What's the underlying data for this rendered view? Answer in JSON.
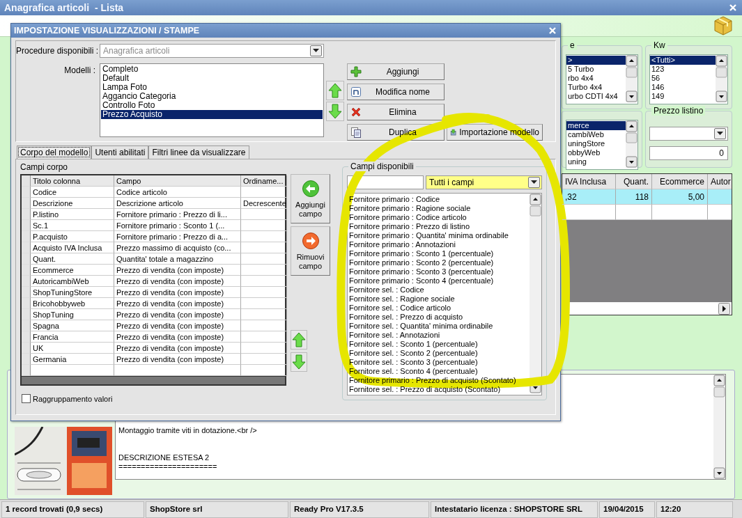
{
  "window": {
    "title": "Anagrafica articoli  - Lista"
  },
  "filters": [
    {
      "title": "e",
      "items": [
        {
          "label": ">",
          "selected": true
        },
        {
          "label": "5 Turbo",
          "selected": false
        },
        {
          "label": "rbo 4x4",
          "selected": false
        },
        {
          "label": "Turbo 4x4",
          "selected": false
        },
        {
          "label": "urbo CDTI 4x4",
          "selected": false
        }
      ]
    },
    {
      "title": "Kw",
      "items": [
        {
          "label": "<Tutti>",
          "selected": true
        },
        {
          "label": "123",
          "selected": false
        },
        {
          "label": "56",
          "selected": false
        },
        {
          "label": "146",
          "selected": false
        },
        {
          "label": "149",
          "selected": false
        }
      ]
    },
    {
      "items": [
        {
          "label": "merce",
          "selected": true
        },
        {
          "label": "cambiWeb",
          "selected": false
        },
        {
          "label": "uningStore",
          "selected": false
        },
        {
          "label": "obbyWeb",
          "selected": false
        },
        {
          "label": "uning",
          "selected": false
        }
      ]
    }
  ],
  "price_list": {
    "title": "Prezzo listino",
    "value": "0"
  },
  "grid": {
    "columns": [
      "IVA Inclusa",
      "Quant.",
      "Ecommerce",
      "Autor"
    ],
    "rows": [
      {
        "cells": [
          ",32",
          "118",
          "5,00"
        ],
        "selected": true
      }
    ]
  },
  "description": {
    "paragraphs": [
      [
        "Montaggio tramite viti in dotazione.<br />"
      ],
      [
        "DESCRIZIONE ESTESA 2",
        "======================"
      ]
    ]
  },
  "status_bar": [
    "1 record trovati (0,9 secs)",
    "ShopStore srl",
    "Ready Pro V17.3.5",
    "Intestatario licenza : SHOPSTORE SRL",
    "19/04/2015",
    "12:20"
  ],
  "dialog": {
    "title": "IMPOSTAZIONE VISUALIZZAZIONI / STAMPE",
    "procedure": {
      "label": "Procedure disponibili :",
      "value": "Anagrafica articoli",
      "disabled": true
    },
    "models": {
      "label": "Modelli :",
      "items": [
        {
          "label": "Completo",
          "selected": false
        },
        {
          "label": "Default",
          "selected": false
        },
        {
          "label": "Lampa Foto",
          "selected": false
        },
        {
          "label": "Aggancio Categoria",
          "selected": false
        },
        {
          "label": "Controllo Foto",
          "selected": false
        },
        {
          "label": "Prezzo Acquisto",
          "selected": true
        }
      ]
    },
    "model_buttons": [
      {
        "label": "Aggiungi"
      },
      {
        "label": "Modifica nome"
      },
      {
        "label": "Elimina"
      },
      {
        "label": "Duplica"
      }
    ],
    "import_button": {
      "label": "Importazione modello"
    },
    "tabs": [
      {
        "label": "Corpo del modello",
        "selected": true
      },
      {
        "label": "Utenti abilitati",
        "selected": false
      },
      {
        "label": "Filtri linee da visualizzare",
        "selected": false
      }
    ],
    "fields": {
      "title": "Campi corpo",
      "columns": [
        "Titolo colonna",
        "Campo",
        "Ordiname..."
      ],
      "rows": [
        [
          "Codice",
          "Codice articolo"
        ],
        [
          "Descrizione",
          "Descrizione articolo",
          "Decrescente"
        ],
        [
          "P.listino",
          "Fornitore primario : Prezzo di li..."
        ],
        [
          "Sc.1",
          "Fornitore primario : Sconto 1 (..."
        ],
        [
          "P.acquisto",
          "Fornitore primario : Prezzo di a..."
        ],
        [
          "Acquisto IVA Inclusa",
          "Prezzo massimo di acquisto (co..."
        ],
        [
          "Quant.",
          "Quantita' totale a magazzino"
        ],
        [
          "Ecommerce",
          "Prezzo di vendita (con imposte)"
        ],
        [
          "AutoricambiWeb",
          "Prezzo di vendita (con imposte)"
        ],
        [
          "ShopTuningStore",
          "Prezzo di vendita (con imposte)"
        ],
        [
          "Bricohobbyweb",
          "Prezzo di vendita (con imposte)"
        ],
        [
          "ShopTuning",
          "Prezzo di vendita (con imposte)"
        ],
        [
          "Spagna",
          "Prezzo di vendita (con imposte)"
        ],
        [
          "Francia",
          "Prezzo di vendita (con imposte)"
        ],
        [
          "UK",
          "Prezzo di vendita (con imposte)"
        ],
        [
          "Germania",
          "Prezzo di vendita (con imposte)"
        ]
      ],
      "buttons": [
        {
          "label": "Aggiungi campo"
        },
        {
          "label": "Rimuovi campo"
        }
      ],
      "grouping": {
        "label": "Raggruppamento valori",
        "checked": false
      }
    },
    "available": {
      "title": "Campi disponibili",
      "filter": "Tutti i campi",
      "items": [
        "Fornitore primario : Codice",
        "Fornitore primario : Ragione sociale",
        "Fornitore primario : Codice articolo",
        "Fornitore primario : Prezzo di listino",
        "Fornitore primario : Quantita' minima ordinabile",
        "Fornitore primario : Annotazioni",
        "Fornitore primario : Sconto 1 (percentuale)",
        "Fornitore primario : Sconto 2 (percentuale)",
        "Fornitore primario : Sconto 3 (percentuale)",
        "Fornitore primario : Sconto 4 (percentuale)",
        "Fornitore sel. : Codice",
        "Fornitore sel. : Ragione sociale",
        "Fornitore sel. : Codice articolo",
        "Fornitore sel. : Prezzo di acquisto",
        "Fornitore sel. : Quantita' minima ordinabile",
        "Fornitore sel. : Annotazioni",
        "Fornitore sel. : Sconto 1 (percentuale)",
        "Fornitore sel. : Sconto 2 (percentuale)",
        "Fornitore sel. : Sconto 3 (percentuale)",
        "Fornitore sel. : Sconto 4 (percentuale)",
        "Fornitore primario : Prezzo di acquisto (Scontato)",
        "Fornitore sel. : Prezzo di acquisto (Scontato)"
      ]
    }
  }
}
